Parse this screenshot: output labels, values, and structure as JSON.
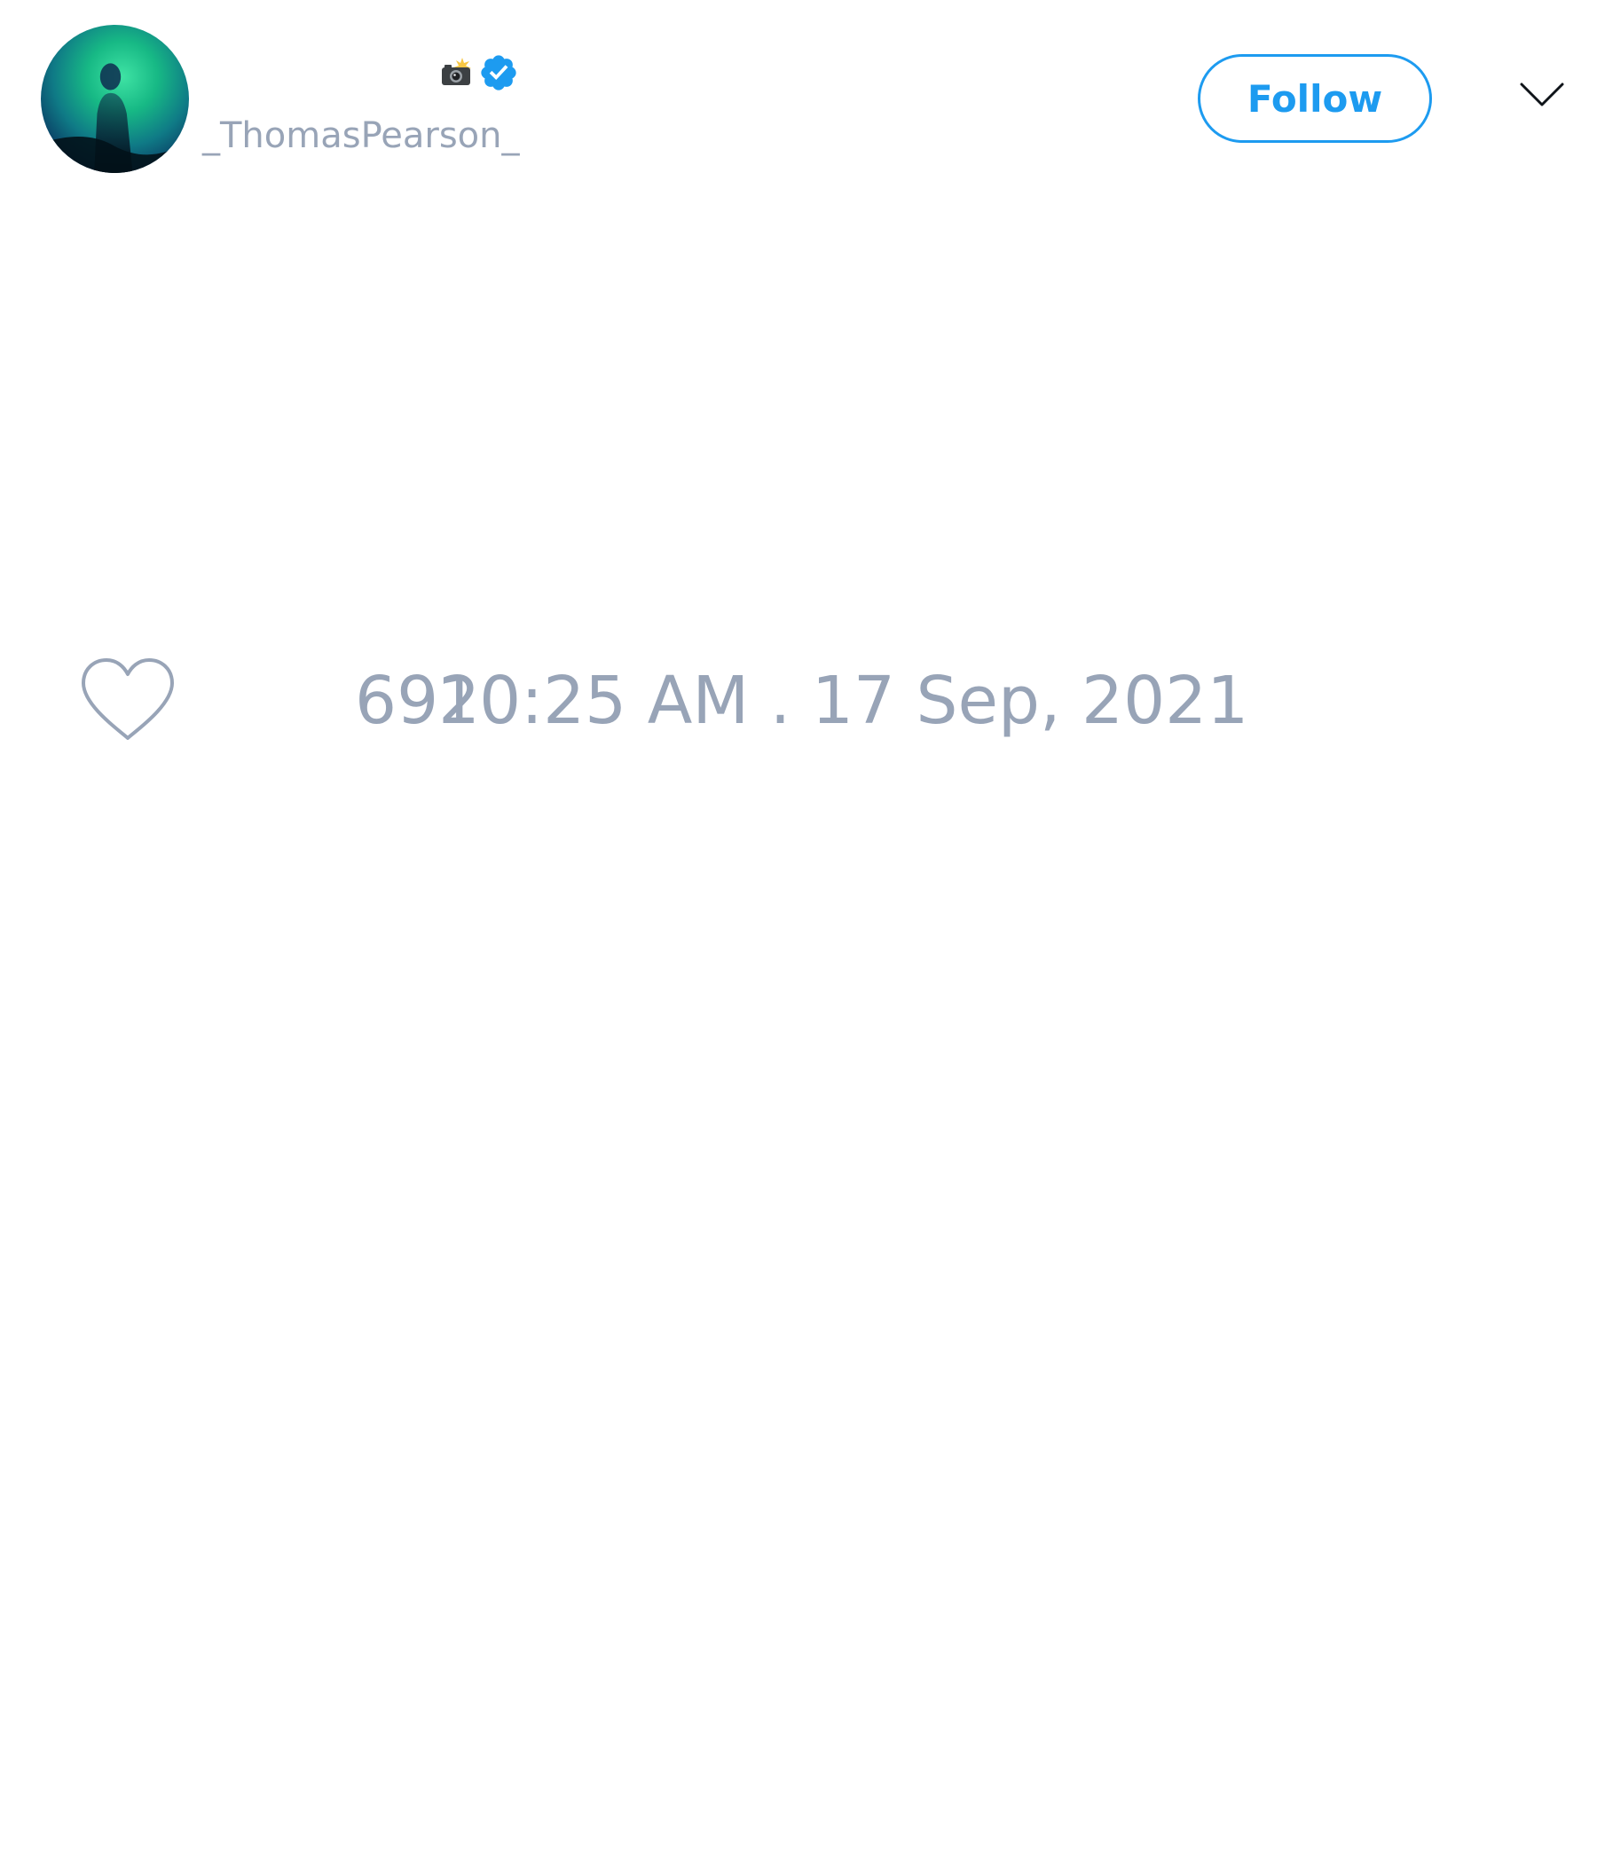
{
  "author": {
    "display_name": "",
    "handle": "_ThomasPearson_",
    "name_emoji_icon": "camera-with-flash-icon",
    "verified": true,
    "verified_icon": "verified-badge-icon"
  },
  "actions": {
    "follow_label": "Follow",
    "more_icon": "chevron-down-icon"
  },
  "stats": {
    "like_icon": "heart-outline-icon",
    "like_count": "692",
    "timestamp": "10:25 AM . 17 Sep, 2021"
  },
  "colors": {
    "accent": "#1d9bf0",
    "muted_text": "#98a4b7"
  }
}
